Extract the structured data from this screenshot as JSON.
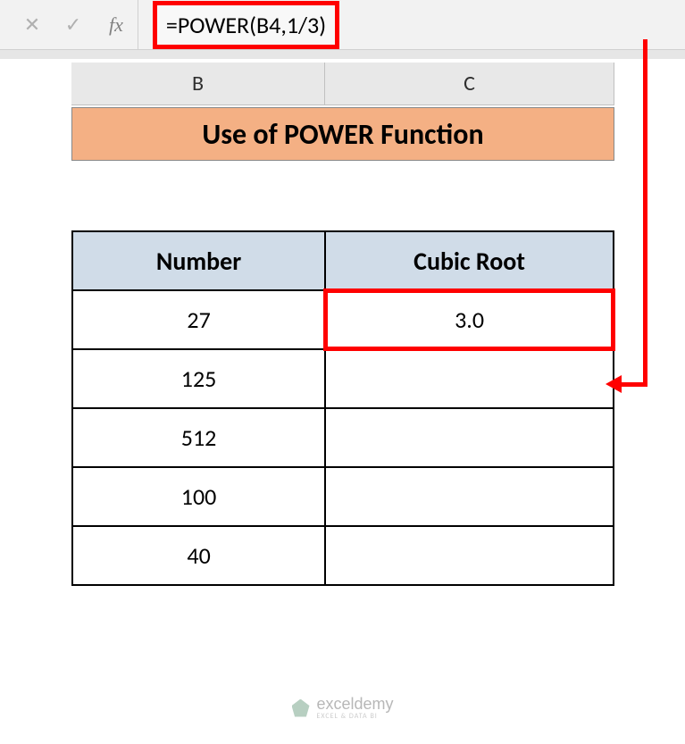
{
  "formula_bar": {
    "cancel_icon": "✕",
    "confirm_icon": "✓",
    "fx_label": "fx",
    "formula": "=POWER(B4,1/3)"
  },
  "columns": {
    "B": "B",
    "C": "C"
  },
  "title": "Use of POWER Function",
  "table": {
    "headers": {
      "number": "Number",
      "cubic_root": "Cubic Root"
    },
    "rows": [
      {
        "number": "27",
        "root": "3.0"
      },
      {
        "number": "125",
        "root": ""
      },
      {
        "number": "512",
        "root": ""
      },
      {
        "number": "100",
        "root": ""
      },
      {
        "number": "40",
        "root": ""
      }
    ]
  },
  "watermark": {
    "brand": "exceldemy",
    "tagline": "EXCEL & DATA BI"
  }
}
